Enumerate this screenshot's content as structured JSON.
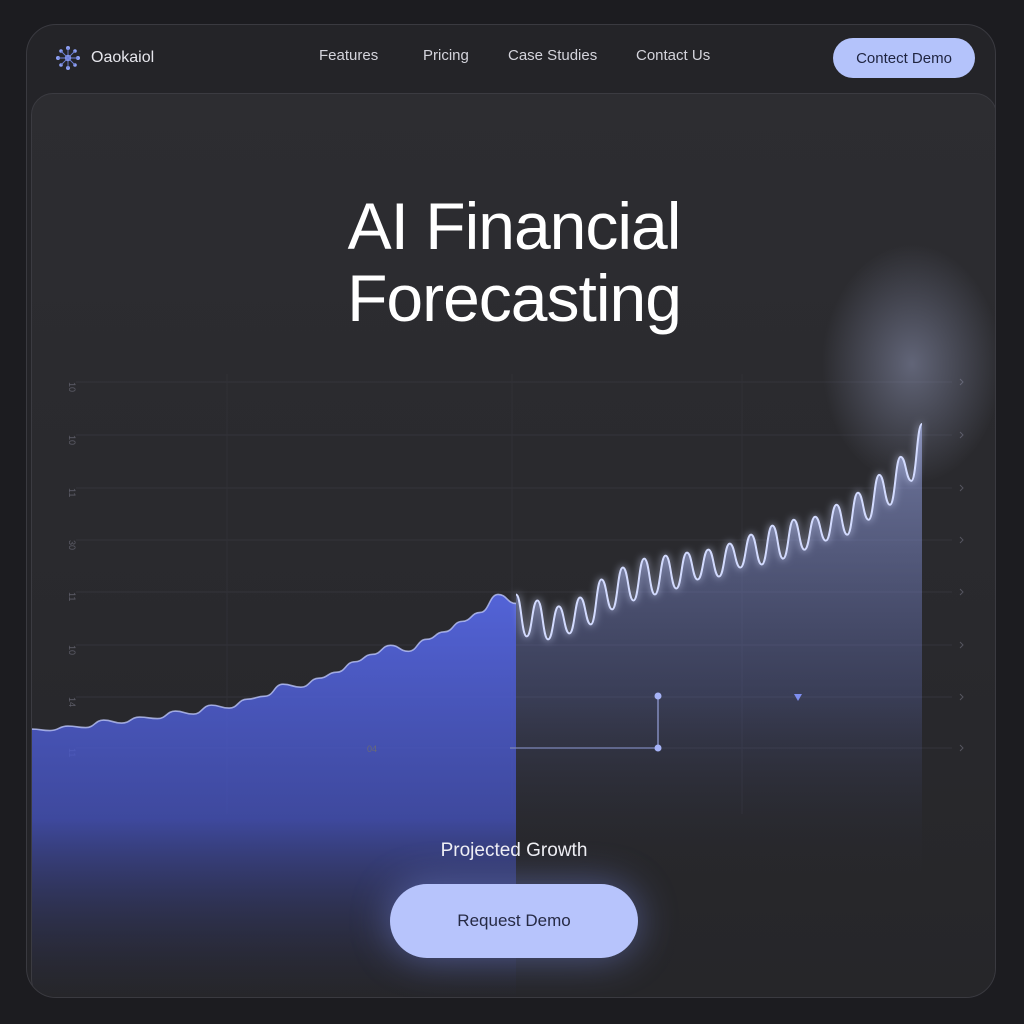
{
  "brand": {
    "name": "Oaokaiol",
    "logo_icon": "network-nodes-icon"
  },
  "nav": {
    "links": [
      "Features",
      "Pricing",
      "Case Studies",
      "Contact Us"
    ],
    "cta_label": "Contect Demo"
  },
  "hero": {
    "title_line1": "AI Financial",
    "title_line2": "Forecasting",
    "caption": "Projected Growth",
    "cta_label": "Request Demo"
  },
  "colors": {
    "accent": "#b4c3fb",
    "area_fill": "#4e5fd6",
    "forecast_line": "#c8d2ff",
    "background": "#242428"
  },
  "chart_data": {
    "type": "area",
    "y_tick_labels": [
      "10",
      "10",
      "11",
      "30",
      "11",
      "10",
      "14",
      "11"
    ],
    "x_tick_label": "04",
    "series": [
      {
        "values": [
          10,
          9,
          12,
          11,
          16,
          14,
          18,
          17,
          22,
          20,
          26,
          24,
          30,
          32,
          40,
          38,
          44,
          48,
          55,
          60,
          66,
          62,
          70,
          75,
          82,
          88,
          100,
          94
        ]
      },
      {
        "values": [
          100,
          72,
          96,
          70,
          92,
          74,
          98,
          80,
          110,
          90,
          118,
          96,
          124,
          100,
          126,
          104,
          128,
          110,
          130,
          112,
          134,
          118,
          140,
          120,
          146,
          124,
          150,
          130,
          152,
          136,
          160,
          140,
          168,
          150,
          180,
          160,
          192,
          176,
          214
        ]
      }
    ],
    "grid": true
  }
}
